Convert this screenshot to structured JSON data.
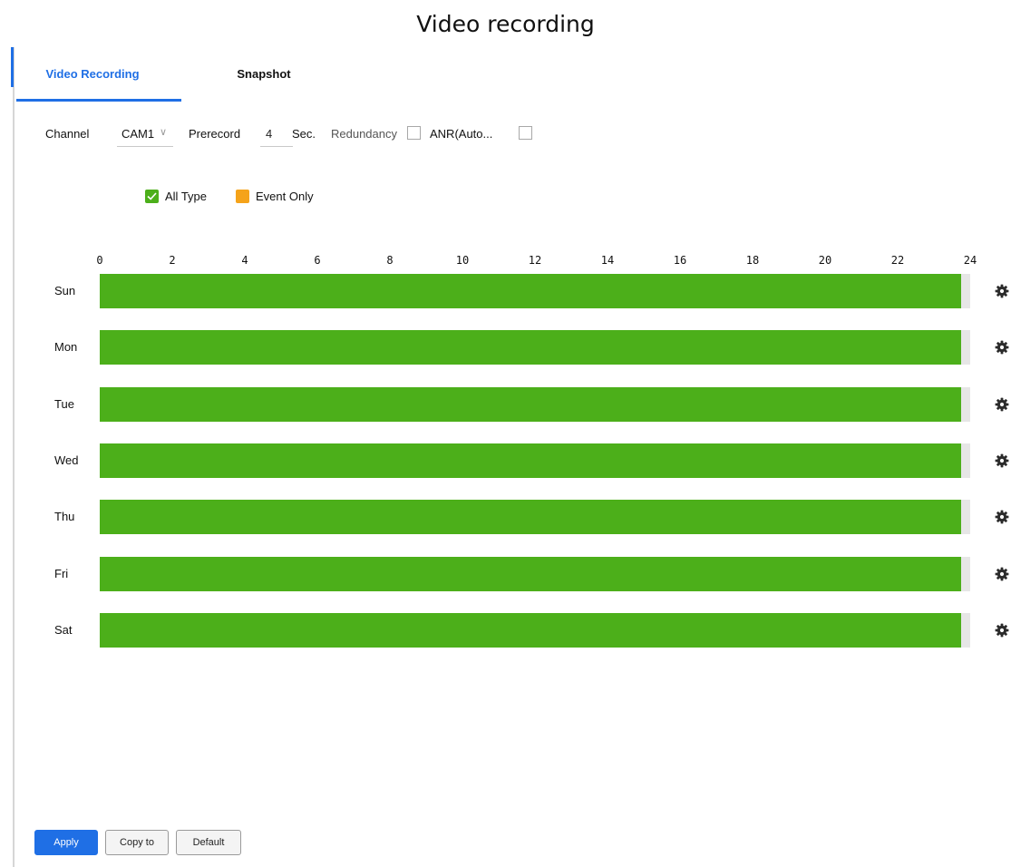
{
  "page": {
    "title": "Video recording"
  },
  "tabs": [
    {
      "label": "Video Recording",
      "active": true
    },
    {
      "label": "Snapshot",
      "active": false
    }
  ],
  "toolbar": {
    "channel_label": "Channel",
    "channel_value": "CAM1",
    "prerecord_label": "Prerecord",
    "prerecord_value": "4",
    "prerecord_unit": "Sec.",
    "redundancy_label": "Redundancy",
    "redundancy_checked": false,
    "anr_label": "ANR(Auto...",
    "anr_checked": false
  },
  "legend": [
    {
      "label": "All Type",
      "color": "#4caf1a",
      "checked": true
    },
    {
      "label": "Event Only",
      "color": "#f5a31a",
      "checked": false
    }
  ],
  "schedule": {
    "hours": [
      "0",
      "2",
      "4",
      "6",
      "8",
      "10",
      "12",
      "14",
      "16",
      "18",
      "20",
      "22",
      "24"
    ],
    "days": [
      {
        "name": "Sun",
        "fill_fraction": 0.99
      },
      {
        "name": "Mon",
        "fill_fraction": 0.99
      },
      {
        "name": "Tue",
        "fill_fraction": 0.99
      },
      {
        "name": "Wed",
        "fill_fraction": 0.99
      },
      {
        "name": "Thu",
        "fill_fraction": 0.99
      },
      {
        "name": "Fri",
        "fill_fraction": 0.99
      },
      {
        "name": "Sat",
        "fill_fraction": 0.99
      }
    ],
    "row_icon": "gear-icon"
  },
  "buttons": {
    "apply": "Apply",
    "copy_to": "Copy to",
    "default": "Default"
  },
  "colors": {
    "accent": "#1f6fe5",
    "all_type": "#4caf1a",
    "event_only": "#f5a31a"
  }
}
